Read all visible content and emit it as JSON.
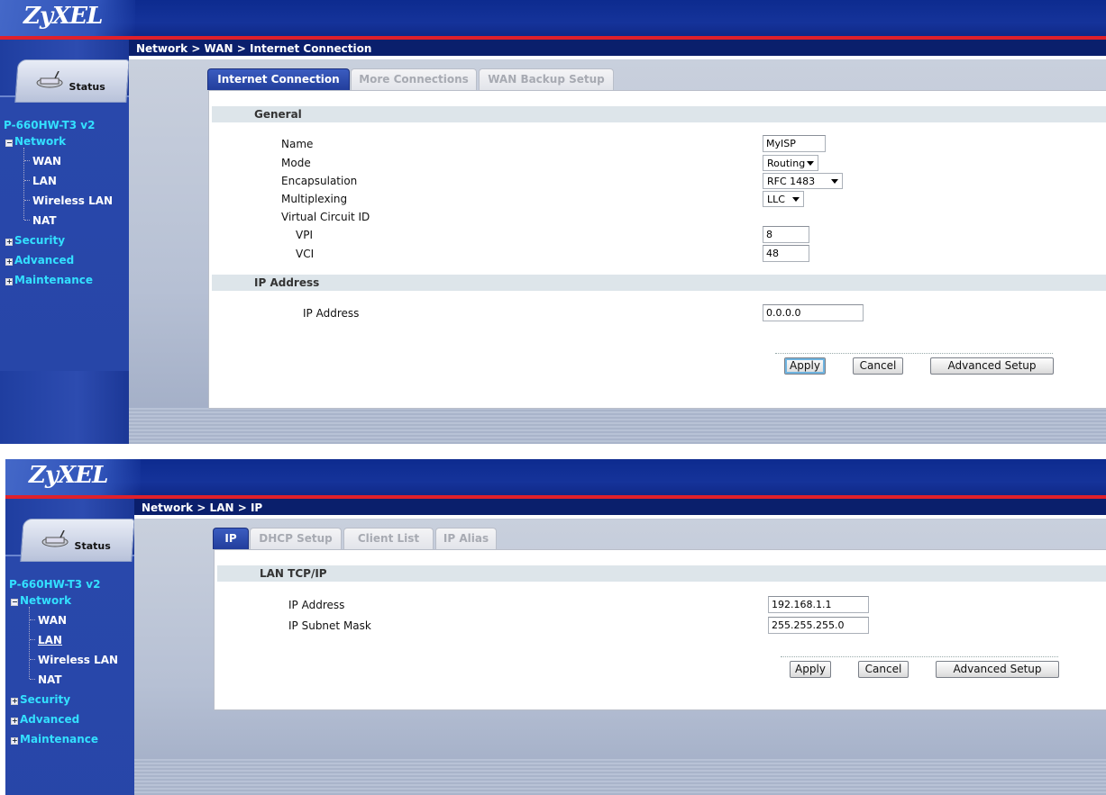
{
  "brand": "ZyXEL",
  "model": "P-660HW-T3 v2",
  "status_label": "Status",
  "nav": {
    "network": "Network",
    "wan": "WAN",
    "lan": "LAN",
    "wireless": "Wireless LAN",
    "nat": "NAT",
    "security": "Security",
    "advanced": "Advanced",
    "maintenance": "Maintenance"
  },
  "buttons": {
    "apply": "Apply",
    "cancel": "Cancel",
    "advanced_setup": "Advanced Setup"
  },
  "wan": {
    "breadcrumb": "Network > WAN > Internet Connection",
    "tabs": [
      "Internet Connection",
      "More Connections",
      "WAN Backup Setup"
    ],
    "general_title": "General",
    "fields": {
      "name_label": "Name",
      "name_value": "MyISP",
      "mode_label": "Mode",
      "mode_value": "Routing",
      "encap_label": "Encapsulation",
      "encap_value": "RFC 1483",
      "mux_label": "Multiplexing",
      "mux_value": "LLC",
      "vc_label": "Virtual Circuit ID",
      "vpi_label": "VPI",
      "vpi_value": "8",
      "vci_label": "VCI",
      "vci_value": "48"
    },
    "ip_title": "IP Address",
    "ip_label": "IP Address",
    "ip_value": "0.0.0.0"
  },
  "lan": {
    "breadcrumb": "Network > LAN > IP",
    "tabs": [
      "IP",
      "DHCP Setup",
      "Client List",
      "IP Alias"
    ],
    "section_title": "LAN TCP/IP",
    "ip_label": "IP Address",
    "ip_value": "192.168.1.1",
    "mask_label": "IP Subnet Mask",
    "mask_value": "255.255.255.0"
  },
  "colors": {
    "accent_cyan": "#33e0ff",
    "banner_blue": "#15339a",
    "red_line": "#e0202a"
  }
}
